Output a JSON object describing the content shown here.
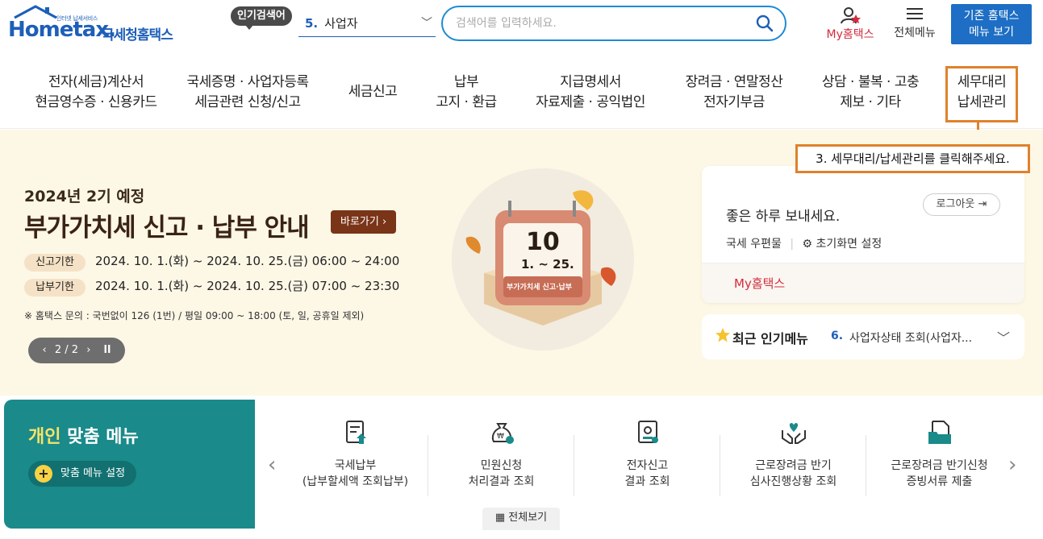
{
  "header": {
    "logo_small": "인터넷 납세서비스",
    "logo_text": "Hometax.",
    "logo_kr": "국세청홈택스",
    "popular_label": "인기검색어",
    "popular_num": "5.",
    "popular_value": "사업자",
    "search_placeholder": "검색어를 입력하세요.",
    "my_hometax": "My홈택스",
    "all_menu": "전체메뉴",
    "old_menu_line1": "기존 홈택스",
    "old_menu_line2": "메뉴 보기"
  },
  "nav": {
    "items": [
      {
        "l1": "전자(세금)계산서",
        "l2": "현금영수증 · 신용카드"
      },
      {
        "l1": "국세증명 · 사업자등록",
        "l2": "세금관련 신청/신고"
      },
      {
        "l1": "세금신고",
        "l2": ""
      },
      {
        "l1": "납부",
        "l2": "고지 · 환급"
      },
      {
        "l1": "지급명세서",
        "l2": "자료제출 · 공익법인"
      },
      {
        "l1": "장려금 · 연말정산",
        "l2": "전자기부금"
      },
      {
        "l1": "상담 · 불복 · 고충",
        "l2": "제보 · 기타"
      },
      {
        "l1": "세무대리",
        "l2": "납세관리"
      }
    ],
    "callout": "3. 세무대리/납세관리를 클릭해주세요."
  },
  "banner": {
    "subtitle": "2024년 2기 예정",
    "title": "부가가치세 신고 · 납부 안내",
    "link": "바로가기 ›",
    "rows": [
      {
        "tag": "신고기한",
        "text": "2024. 10. 1.(화) ~ 2024. 10. 25.(금) 06:00 ~ 24:00"
      },
      {
        "tag": "납부기한",
        "text": "2024. 10. 1.(화) ~ 2024. 10. 25.(금) 07:00 ~ 23:30"
      }
    ],
    "note": "※ 홈택스 문의 : 국번없이 126 (1번) / 평일 09:00 ~ 18:00 (토, 일, 공휴일 제외)",
    "pager": "2 / 2",
    "cal_day": "10",
    "cal_range": "1. ~ 25.",
    "cal_label": "부가가치세 신고·납부"
  },
  "panel": {
    "greeting": "좋은 하루 보내세요.",
    "logout": "로그아웃",
    "mailbox": "국세 우편물",
    "settings": "초기화면 설정",
    "my_hometax": "My홈택스"
  },
  "recent": {
    "title": "최근 인기메뉴",
    "num": "6.",
    "value": "사업자상태 조회(사업자..."
  },
  "personal": {
    "title_hl": "개인",
    "title_rest": " 맞춤 메뉴",
    "setting": "맞춤 메뉴 설정"
  },
  "quick": {
    "items": [
      {
        "l1": "국세납부",
        "l2": "(납부할세액 조회납부)",
        "icon": "tax-payment-icon"
      },
      {
        "l1": "민원신청",
        "l2": "처리결과 조회",
        "icon": "money-bag-icon"
      },
      {
        "l1": "전자신고",
        "l2": "결과 조회",
        "icon": "certificate-icon"
      },
      {
        "l1": "근로장려금 반기",
        "l2": "심사진행상황 조회",
        "icon": "hands-heart-icon"
      },
      {
        "l1": "근로장려금 반기신청",
        "l2": "증빙서류 제출",
        "icon": "document-folder-icon"
      }
    ],
    "view_all": "전체보기"
  },
  "colors": {
    "brand_blue": "#1d5fb8",
    "accent_red": "#d22c3e",
    "callout_orange": "#e0812b",
    "teal": "#1a8a8a"
  }
}
